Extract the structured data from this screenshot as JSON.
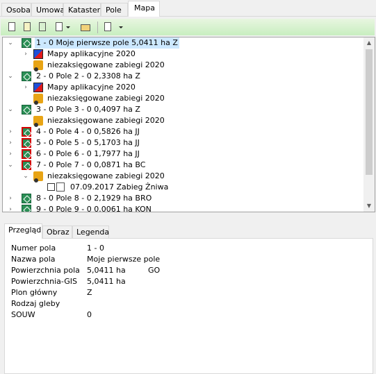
{
  "top_tabs": [
    "Osoba",
    "Umowa",
    "Kataster",
    "Pole",
    "Mapa"
  ],
  "active_tab": "Mapa",
  "toolbar": {
    "icons": [
      "new-document-icon",
      "document-list-icon",
      "excel-document-icon",
      "document-options-icon",
      "folder-export-icon",
      "blank-document-icon"
    ]
  },
  "tree": {
    "rows": [
      {
        "label": "1 - 0 Moje pierwsze pole 5,0411 ha Z",
        "icon": "field-icon"
      },
      {
        "label": "Mapy aplikacyjne 2020",
        "icon": "map-icon"
      },
      {
        "label": "niezaksięgowane zabiegi 2020",
        "icon": "tractor-icon"
      },
      {
        "label": "2 - 0 Pole 2 - 0 2,3308 ha Z",
        "icon": "field-icon"
      },
      {
        "label": "Mapy aplikacyjne 2020",
        "icon": "map-icon"
      },
      {
        "label": "niezaksięgowane zabiegi 2020",
        "icon": "tractor-icon"
      },
      {
        "label": "3 - 0 Pole 3 - 0 0,4097 ha Z",
        "icon": "field-icon"
      },
      {
        "label": "niezaksięgowane zabiegi 2020",
        "icon": "tractor-icon"
      },
      {
        "label": "4 - 0 Pole 4 - 0 0,5826 ha JJ",
        "icon": "field-icon"
      },
      {
        "label": "5 - 0 Pole 5 - 0 5,1703 ha JJ",
        "icon": "field-icon"
      },
      {
        "label": "6 - 0 Pole 6 - 0 1,7977 ha JJ",
        "icon": "field-icon"
      },
      {
        "label": "7 - 0 Pole 7 - 0 0,0871 ha BC",
        "icon": "field-icon"
      },
      {
        "label": "niezaksięgowane zabiegi 2020",
        "icon": "tractor-icon"
      },
      {
        "label": "07.09.2017 Zabieg Żniwa",
        "icon": "treatment-doc-icon"
      },
      {
        "label": "8 - 0 Pole 8 - 0 2,1929 ha BRO",
        "icon": "field-icon"
      },
      {
        "label": "9 - 0 Pole 9 - 0 0.0061 ha KON",
        "icon": "field-icon"
      }
    ]
  },
  "bottom_tabs": [
    "Przegląd",
    "Obraz",
    "Legenda"
  ],
  "active_bottom_tab": "Przegląd",
  "details": {
    "rows": [
      {
        "label": "Numer pola",
        "value": "1 - 0",
        "extra": ""
      },
      {
        "label": "Nazwa pola",
        "value": "Moje pierwsze pole",
        "extra": ""
      },
      {
        "label": "Powierzchnia pola",
        "value": "5,0411 ha",
        "extra": "GO"
      },
      {
        "label": "Powierzchnia-GIS",
        "value": "5,0411 ha",
        "extra": ""
      },
      {
        "label": "Plon główny",
        "value": "Z",
        "extra": ""
      },
      {
        "label": "Rodzaj gleby",
        "value": "",
        "extra": ""
      },
      {
        "label": "SOUW",
        "value": "0",
        "extra": ""
      }
    ]
  }
}
